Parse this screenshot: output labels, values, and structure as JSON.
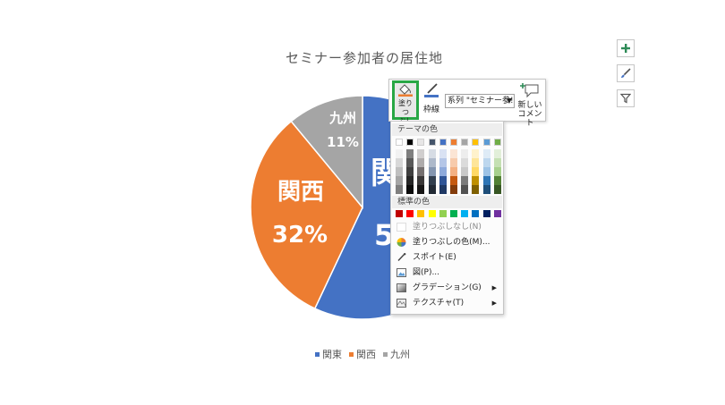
{
  "chart": {
    "title": "セミナー参加者の居住地",
    "legend": [
      {
        "label": "関東",
        "color": "#4472c4"
      },
      {
        "label": "関西",
        "color": "#ed7d31"
      },
      {
        "label": "九州",
        "color": "#a5a5a5"
      }
    ]
  },
  "chart_data": {
    "type": "pie",
    "title": "セミナー参加者の居住地",
    "categories": [
      "関東",
      "関西",
      "九州"
    ],
    "values": [
      57,
      32,
      11
    ],
    "colors": [
      "#4472c4",
      "#ed7d31",
      "#a5a5a5"
    ],
    "data_labels": [
      {
        "category": "関東",
        "text": "関",
        "value_text": "5"
      },
      {
        "category": "関西",
        "text": "関西",
        "value_text": "32%"
      },
      {
        "category": "九州",
        "text": "九州",
        "value_text": "11%"
      }
    ],
    "legend_position": "bottom"
  },
  "side_buttons": {
    "elements_icon": "plus-icon",
    "styles_icon": "brush-icon",
    "filter_icon": "filter-icon"
  },
  "toolbar": {
    "fill_label_1": "塗りつ",
    "fill_label_2": "ぶし",
    "outline_label": "枠線",
    "series_value": "系列 \"セミナー参!",
    "comment_label_1": "新しい",
    "comment_label_2": "コメント"
  },
  "dropdown": {
    "theme_colors_header": "テーマの色",
    "standard_colors_header": "標準の色",
    "theme_top_row": [
      "#ffffff",
      "#000000",
      "#e7e6e6",
      "#44546a",
      "#4472c4",
      "#ed7d31",
      "#a5a5a5",
      "#ffc000",
      "#5b9bd5",
      "#70ad47"
    ],
    "theme_shades": [
      [
        "#f2f2f2",
        "#7f7f7f",
        "#d0cece",
        "#d6dce4",
        "#d9e2f3",
        "#fbe5d5",
        "#ededed",
        "#fff2cc",
        "#deebf6",
        "#e2efd9"
      ],
      [
        "#d8d8d8",
        "#595959",
        "#aeabab",
        "#adb9ca",
        "#b4c6e7",
        "#f7cbac",
        "#dbdbdb",
        "#fee599",
        "#bdd7ee",
        "#c5e0b3"
      ],
      [
        "#bfbfbf",
        "#3f3f3f",
        "#757070",
        "#8496b0",
        "#8eaadb",
        "#f4b183",
        "#c9c9c9",
        "#ffd965",
        "#9dc3e6",
        "#a8d08d"
      ],
      [
        "#a5a5a5",
        "#262626",
        "#3a3838",
        "#323f4f",
        "#2f5496",
        "#c55a11",
        "#7b7b7b",
        "#bf9000",
        "#2e75b5",
        "#538135"
      ],
      [
        "#7f7f7f",
        "#0c0c0c",
        "#171616",
        "#222a35",
        "#1f3864",
        "#833c0b",
        "#525252",
        "#7f6000",
        "#1e4e79",
        "#375623"
      ]
    ],
    "standard_colors": [
      "#c00000",
      "#ff0000",
      "#ffc000",
      "#ffff00",
      "#92d050",
      "#00b050",
      "#00b0f0",
      "#0070c0",
      "#002060",
      "#7030a0"
    ],
    "items": {
      "no_fill": "塗りつぶしなし(N)",
      "more_colors": "塗りつぶしの色(M)...",
      "eyedropper": "スポイト(E)",
      "picture": "図(P)...",
      "gradient": "グラデーション(G)",
      "texture": "テクスチャ(T)"
    }
  }
}
